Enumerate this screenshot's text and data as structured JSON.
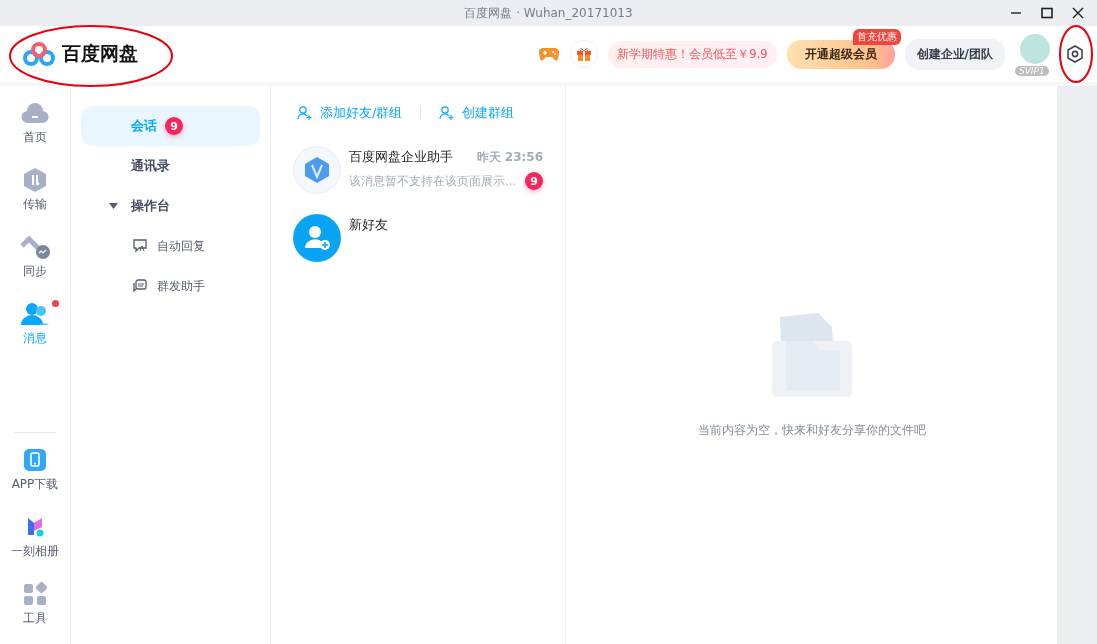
{
  "window": {
    "title": "百度网盘 · Wuhan_20171013"
  },
  "header": {
    "logo_text": "百度网盘",
    "promo": "新学期特惠！会员低至￥9.9",
    "vip_button": "开通超级会员",
    "vip_tag": "首充优惠",
    "team_button": "创建企业/团队",
    "avatar_badge": "SVIP1"
  },
  "rail": {
    "items": [
      {
        "label": "首页",
        "kind": "cloud",
        "selected": false,
        "unread": false
      },
      {
        "label": "传输",
        "kind": "transfer",
        "selected": false,
        "unread": false
      },
      {
        "label": "同步",
        "kind": "sync",
        "selected": false,
        "unread": false
      },
      {
        "label": "消息",
        "kind": "people",
        "selected": true,
        "unread": true
      }
    ],
    "bottom_items": [
      {
        "label": "APP下载",
        "kind": "phone"
      },
      {
        "label": "一刻相册",
        "kind": "album"
      },
      {
        "label": "工具",
        "kind": "tools"
      }
    ]
  },
  "nav": {
    "items": [
      {
        "label": "会话",
        "badge": "9",
        "selected": true
      },
      {
        "label": "通讯录",
        "selected": false
      },
      {
        "label": "操作台",
        "selected": false,
        "expanded": true,
        "children": [
          {
            "label": "自动回复",
            "kind": "reply"
          },
          {
            "label": "群发助手",
            "kind": "broadcast"
          }
        ]
      }
    ]
  },
  "chat_actions": [
    "添加好友/群组",
    "创建群组"
  ],
  "conversations": [
    {
      "name": "百度网盘企业助手",
      "time": "昨天 23:56",
      "preview": "该消息暂不支持在该页面展示...",
      "badge": "9",
      "kind": "assistant"
    },
    {
      "name": "新好友",
      "kind": "new-friend"
    }
  ],
  "empty": {
    "message": "当前内容为空，快来和好友分享你的文件吧"
  }
}
